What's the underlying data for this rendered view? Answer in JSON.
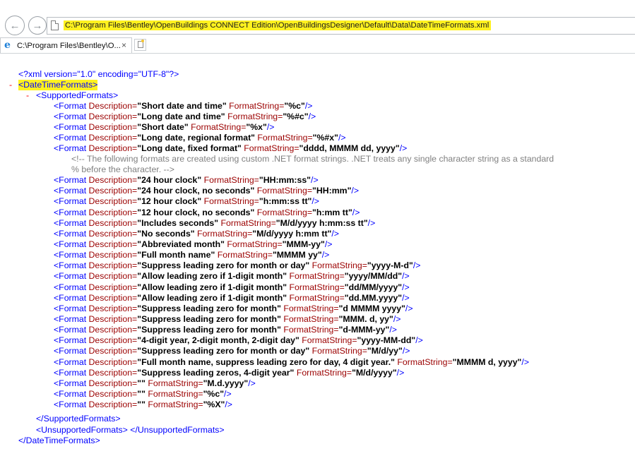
{
  "browser": {
    "address": "C:\\Program Files\\Bentley\\OpenBuildings CONNECT Edition\\OpenBuildingsDesigner\\Default\\Data\\DateTimeFormats.xml",
    "tab_title": "C:\\Program Files\\Bentley\\O...",
    "tab_close": "×",
    "back_icon": "back-arrow-icon",
    "forward_icon": "forward-arrow-icon",
    "tab_icon": "ie-logo-icon"
  },
  "xml": {
    "decl": "<?xml version=\"1.0\" encoding=\"UTF-8\"?>",
    "minus": "-",
    "root_open": "<DateTimeFormats>",
    "supported_open": "<SupportedFormats>",
    "supported_close": "</SupportedFormats>",
    "unsupported": "<UnsupportedFormats> </UnsupportedFormats>",
    "root_close": "</DateTimeFormats>",
    "tag_start": "<Format ",
    "tag_end": "/>",
    "attr_desc": "Description=",
    "attr_fmt": "FormatString=",
    "comment_line1": "<!-- The following formats are created using custom .NET format strings. .NET treats any single character string as a standard",
    "comment_line2": "% before the character. -->",
    "formats": [
      {
        "desc": "\"Short date and time\"",
        "fmt": "\"%c\""
      },
      {
        "desc": "\"Long date and time\"",
        "fmt": "\"%#c\""
      },
      {
        "desc": "\"Short date\"",
        "fmt": "\"%x\""
      },
      {
        "desc": "\"Long date, regional format\"",
        "fmt": "\"%#x\""
      },
      {
        "desc": "\"Long date, fixed format\"",
        "fmt": "\"dddd, MMMM dd, yyyy\""
      },
      {
        "desc": "\"24 hour clock\"",
        "fmt": "\"HH:mm:ss\""
      },
      {
        "desc": "\"24 hour clock, no seconds\"",
        "fmt": "\"HH:mm\""
      },
      {
        "desc": "\"12 hour clock\"",
        "fmt": "\"h:mm:ss tt\""
      },
      {
        "desc": "\"12 hour clock, no seconds\"",
        "fmt": "\"h:mm tt\""
      },
      {
        "desc": "\"Includes seconds\"",
        "fmt": "\"M/d/yyyy h:mm:ss tt\""
      },
      {
        "desc": "\"No seconds\"",
        "fmt": "\"M/d/yyyy h:mm tt\""
      },
      {
        "desc": "\"Abbreviated month\"",
        "fmt": "\"MMM-yy\""
      },
      {
        "desc": "\"Full month name\"",
        "fmt": "\"MMMM yy\""
      },
      {
        "desc": "\"Suppress leading zero for month or day\"",
        "fmt": "\"yyyy-M-d\""
      },
      {
        "desc": "\"Allow leading zero if 1-digit month\"",
        "fmt": "\"yyyy/MM/dd\""
      },
      {
        "desc": "\"Allow leading zero if 1-digit month\"",
        "fmt": "\"dd/MM/yyyy\""
      },
      {
        "desc": "\"Allow leading zero if 1-digit month\"",
        "fmt": "\"dd.MM.yyyy\""
      },
      {
        "desc": "\"Suppress leading zero for month\"",
        "fmt": "\"d MMMM yyyy\""
      },
      {
        "desc": "\"Suppress leading zero for month\"",
        "fmt": "\"MMM. d, yy\""
      },
      {
        "desc": "\"Suppress leading zero for month\"",
        "fmt": "\"d-MMM-yy\""
      },
      {
        "desc": "\"4-digit year, 2-digit month, 2-digit day\"",
        "fmt": "\"yyyy-MM-dd\""
      },
      {
        "desc": "\"Suppress leading zero for month or day\"",
        "fmt": "\"M/d/yy\""
      },
      {
        "desc": "\"Full month name, suppress leading zero for day, 4 digit year.\"",
        "fmt": "\"MMMM d, yyyy\""
      },
      {
        "desc": "\"Suppress leading zeros, 4-digit year\"",
        "fmt": "\"M/d/yyyy\""
      },
      {
        "desc": "\"\"",
        "fmt": "\"M.d.yyyy\""
      },
      {
        "desc": "\"\"",
        "fmt": "\"%c\""
      },
      {
        "desc": "\"\"",
        "fmt": "\"%X\""
      }
    ]
  },
  "colors": {
    "tag": "#0000ff",
    "attr": "#9b0000",
    "value": "#000000",
    "comment": "#808080",
    "collapse_marker": "#ff0000",
    "highlight": "#fff21f"
  }
}
